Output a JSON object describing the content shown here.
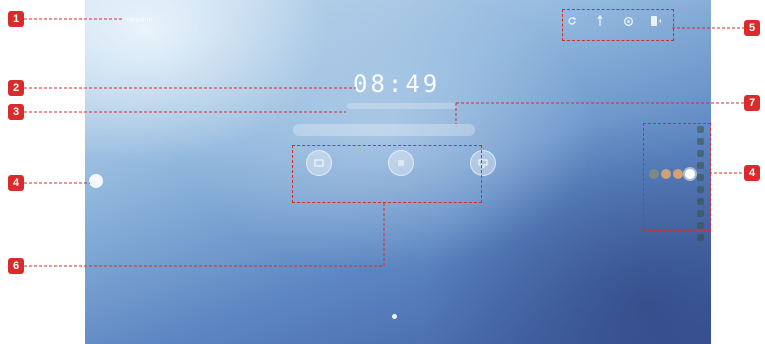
{
  "screen": {
    "brand": "newline",
    "clock": "08:49"
  },
  "status_icons": [
    "refresh-icon",
    "usb-icon",
    "settings-icon",
    "signal-icon"
  ],
  "apps": [
    {
      "icon": "whiteboard-icon"
    },
    {
      "icon": "menu-icon"
    },
    {
      "icon": "screen-share-icon"
    }
  ],
  "toolbar": {
    "colors": [
      "#7a8a88",
      "#c9a27a",
      "#d6a070",
      "#ffffff"
    ]
  },
  "callouts": [
    "1",
    "2",
    "3",
    "4",
    "4",
    "5",
    "6",
    "7"
  ],
  "colors": {
    "callout": "#d92b2b"
  }
}
